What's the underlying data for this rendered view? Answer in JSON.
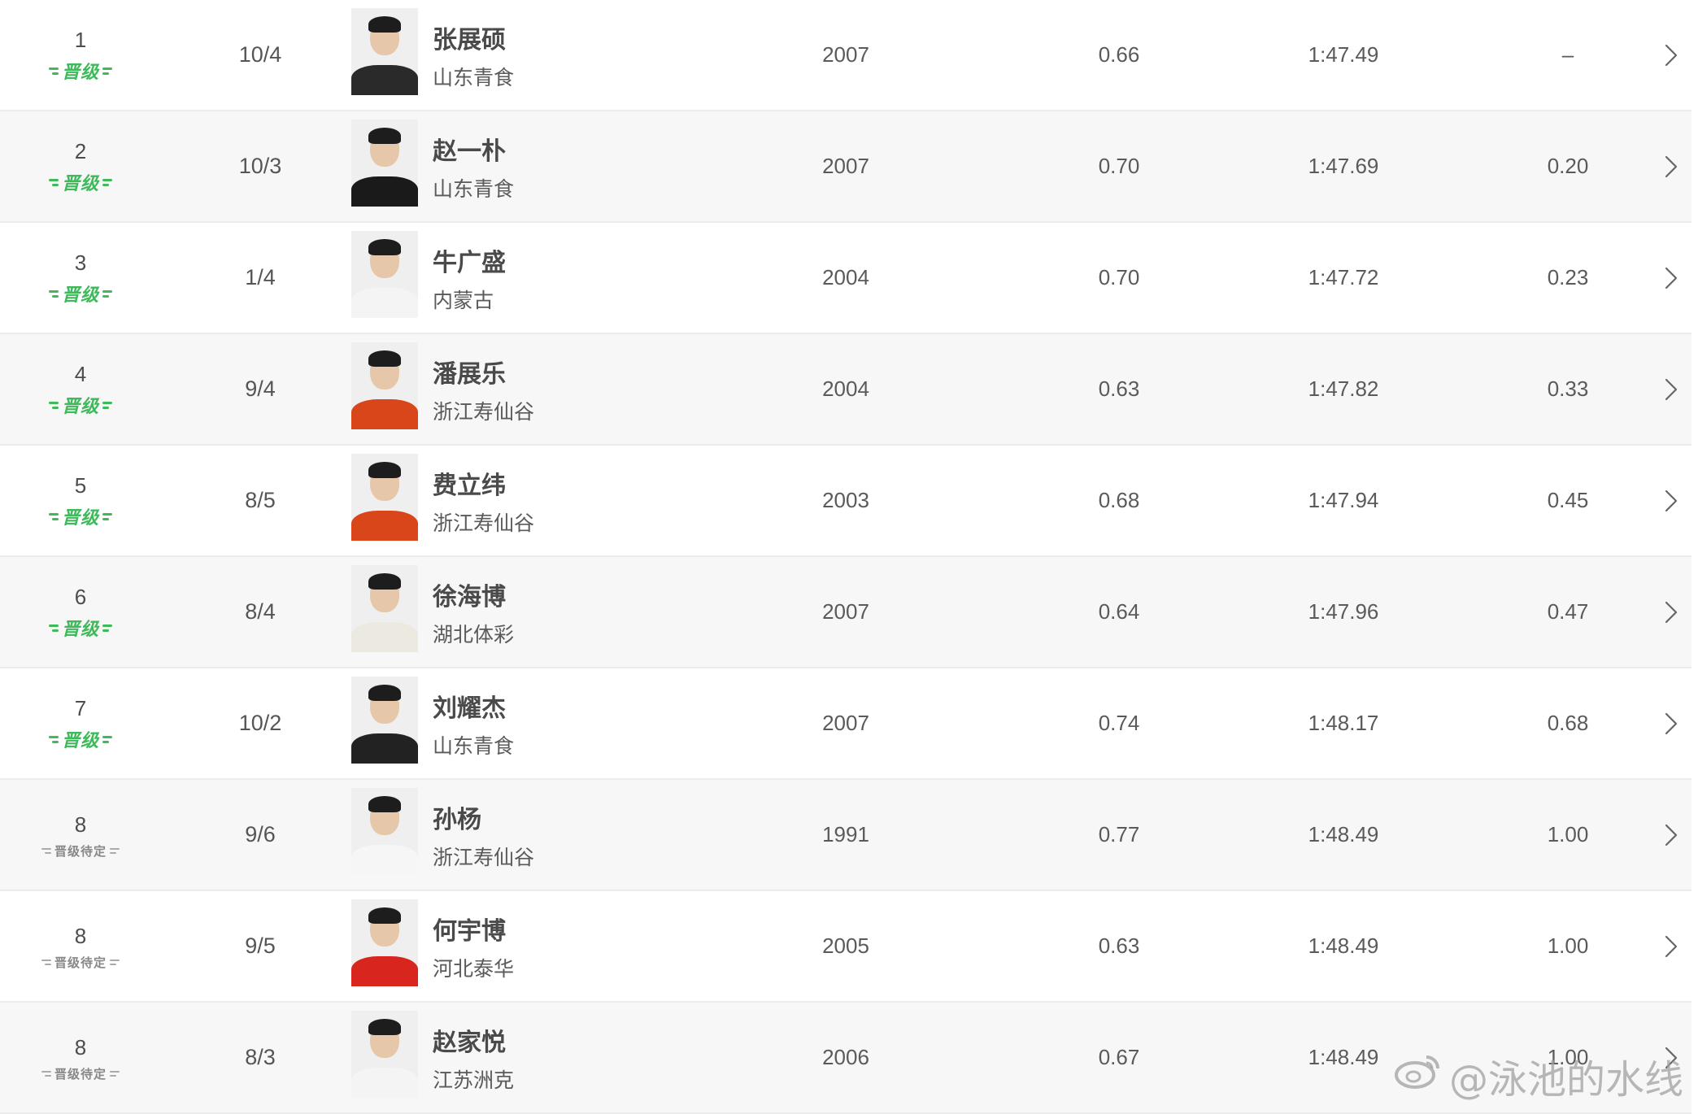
{
  "qualify_labels": {
    "green": "晋级",
    "gray": "晋级待定"
  },
  "colors": {
    "qualified": "#3fba5b",
    "pending": "#888888",
    "row_alt": "#f7f7f7"
  },
  "rows": [
    {
      "rank": "1",
      "status": "green",
      "lane": "10/4",
      "name": "张展硕",
      "team": "山东青食",
      "year": "2007",
      "reaction": "0.66",
      "time": "1:47.49",
      "diff": "–",
      "jersey": "#2a2a2a"
    },
    {
      "rank": "2",
      "status": "green",
      "lane": "10/3",
      "name": "赵一朴",
      "team": "山东青食",
      "year": "2007",
      "reaction": "0.70",
      "time": "1:47.69",
      "diff": "0.20",
      "jersey": "#1a1a1a"
    },
    {
      "rank": "3",
      "status": "green",
      "lane": "1/4",
      "name": "牛广盛",
      "team": "内蒙古",
      "year": "2004",
      "reaction": "0.70",
      "time": "1:47.72",
      "diff": "0.23",
      "jersey": "#f4f4f4"
    },
    {
      "rank": "4",
      "status": "green",
      "lane": "9/4",
      "name": "潘展乐",
      "team": "浙江寿仙谷",
      "year": "2004",
      "reaction": "0.63",
      "time": "1:47.82",
      "diff": "0.33",
      "jersey": "#d9461a"
    },
    {
      "rank": "5",
      "status": "green",
      "lane": "8/5",
      "name": "费立纬",
      "team": "浙江寿仙谷",
      "year": "2003",
      "reaction": "0.68",
      "time": "1:47.94",
      "diff": "0.45",
      "jersey": "#d9461a"
    },
    {
      "rank": "6",
      "status": "green",
      "lane": "8/4",
      "name": "徐海博",
      "team": "湖北体彩",
      "year": "2007",
      "reaction": "0.64",
      "time": "1:47.96",
      "diff": "0.47",
      "jersey": "#ece9e0"
    },
    {
      "rank": "7",
      "status": "green",
      "lane": "10/2",
      "name": "刘耀杰",
      "team": "山东青食",
      "year": "2007",
      "reaction": "0.74",
      "time": "1:48.17",
      "diff": "0.68",
      "jersey": "#222222"
    },
    {
      "rank": "8",
      "status": "gray",
      "lane": "9/6",
      "name": "孙杨",
      "team": "浙江寿仙谷",
      "year": "1991",
      "reaction": "0.77",
      "time": "1:48.49",
      "diff": "1.00",
      "jersey": "#f6f6f6"
    },
    {
      "rank": "8",
      "status": "gray",
      "lane": "9/5",
      "name": "何宇博",
      "team": "河北泰华",
      "year": "2005",
      "reaction": "0.63",
      "time": "1:48.49",
      "diff": "1.00",
      "jersey": "#d8261e"
    },
    {
      "rank": "8",
      "status": "gray",
      "lane": "8/3",
      "name": "赵家悦",
      "team": "江苏洲克",
      "year": "2006",
      "reaction": "0.67",
      "time": "1:48.49",
      "diff": "1.00",
      "jersey": "#f4f4f4"
    }
  ],
  "watermark": {
    "text": "@泳池的水线",
    "icon": "weibo-logo-icon"
  }
}
